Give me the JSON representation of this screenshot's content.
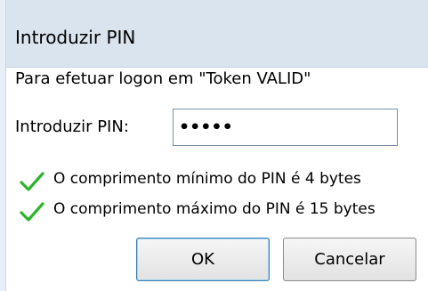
{
  "dialog": {
    "title": "Introduzir PIN",
    "message": "Para efetuar logon em \"Token VALID\"",
    "pin_label": "Introduzir PIN:",
    "pin_value": "•••••",
    "rules": [
      {
        "icon": "checkmark-icon",
        "text": "O comprimento mínimo do PIN é 4 bytes"
      },
      {
        "icon": "checkmark-icon",
        "text": "O comprimento máximo do PIN é 15 bytes"
      }
    ],
    "buttons": {
      "ok_label": "OK",
      "cancel_label": "Cancelar"
    }
  },
  "colors": {
    "title_bar": "#dae4ef",
    "check": "#2bb52b",
    "ok_border": "#3c7fb1"
  }
}
